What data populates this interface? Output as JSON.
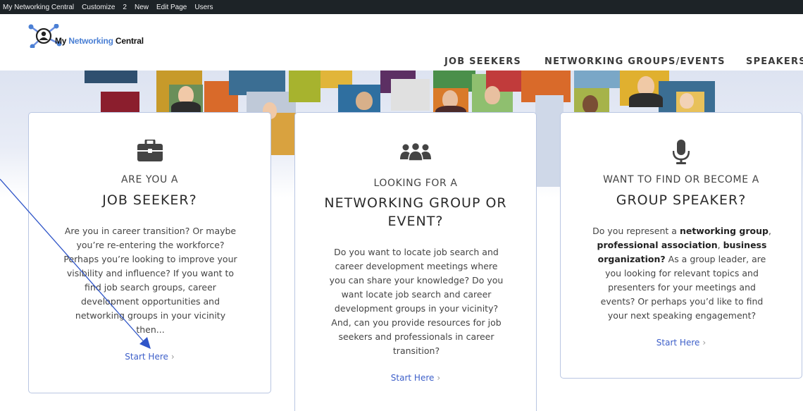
{
  "admin_bar": {
    "items": [
      "My Networking Central",
      "Customize",
      "2",
      "New",
      "Edit Page",
      "Users"
    ]
  },
  "logo": {
    "part1": "My ",
    "part2": "Networking",
    "part3": " Central"
  },
  "nav": {
    "items": [
      "JOB SEEKERS",
      "NETWORKING GROUPS/EVENTS",
      "SPEAKERS"
    ]
  },
  "cards": [
    {
      "icon": "briefcase-icon",
      "pre": "ARE YOU A",
      "heading": [
        "JOB SEEKER?"
      ],
      "desc_lines": [
        "Are you in career transition? Or maybe",
        "you’re re-entering the workforce?",
        "Perhaps you’re looking to improve your",
        "visibility and influence? If you want to",
        "find job search groups, career",
        "development opportunities and",
        "networking groups in your vicinity",
        "then..."
      ],
      "cta": "Start Here",
      "chevron": "›"
    },
    {
      "icon": "group-icon",
      "pre": "LOOKING FOR A",
      "heading": [
        "NETWORKING GROUP OR",
        "EVENT?"
      ],
      "desc_lines": [
        "Do you want to locate job search and",
        "career development meetings where",
        "you can share your knowledge? Do you",
        "want locate job search and career",
        "development groups in your vicinity?",
        "And, can you provide resources for job",
        "seekers and professionals in career",
        "transition?"
      ],
      "cta": "Start Here",
      "chevron": "›"
    },
    {
      "icon": "microphone-icon",
      "pre": "WANT TO FIND OR BECOME A",
      "heading": [
        "GROUP SPEAKER?"
      ],
      "desc_segments": [
        [
          {
            "t": "Do you represent a ",
            "b": false
          },
          {
            "t": "networking group",
            "b": true
          },
          {
            "t": ",",
            "b": false
          }
        ],
        [
          {
            "t": "professional association",
            "b": true
          },
          {
            "t": ", ",
            "b": false
          },
          {
            "t": "business",
            "b": true
          }
        ],
        [
          {
            "t": "organization?",
            "b": true
          },
          {
            "t": "  As a group leader, are",
            "b": false
          }
        ],
        [
          {
            "t": "you looking for relevant topics and",
            "b": false
          }
        ],
        [
          {
            "t": "presenters for your meetings and",
            "b": false
          }
        ],
        [
          {
            "t": "events? Or perhaps you’d like to find",
            "b": false
          }
        ],
        [
          {
            "t": "your next speaking engagement?",
            "b": false
          }
        ]
      ],
      "cta": "Start Here",
      "chevron": "›"
    }
  ],
  "colors": {
    "admin_bg": "#1d2327",
    "brand_blue": "#4a7fd4",
    "cta_blue": "#3d5fc9",
    "card_border": "#b9c6e2",
    "annotation_line": "#2f55c8"
  }
}
